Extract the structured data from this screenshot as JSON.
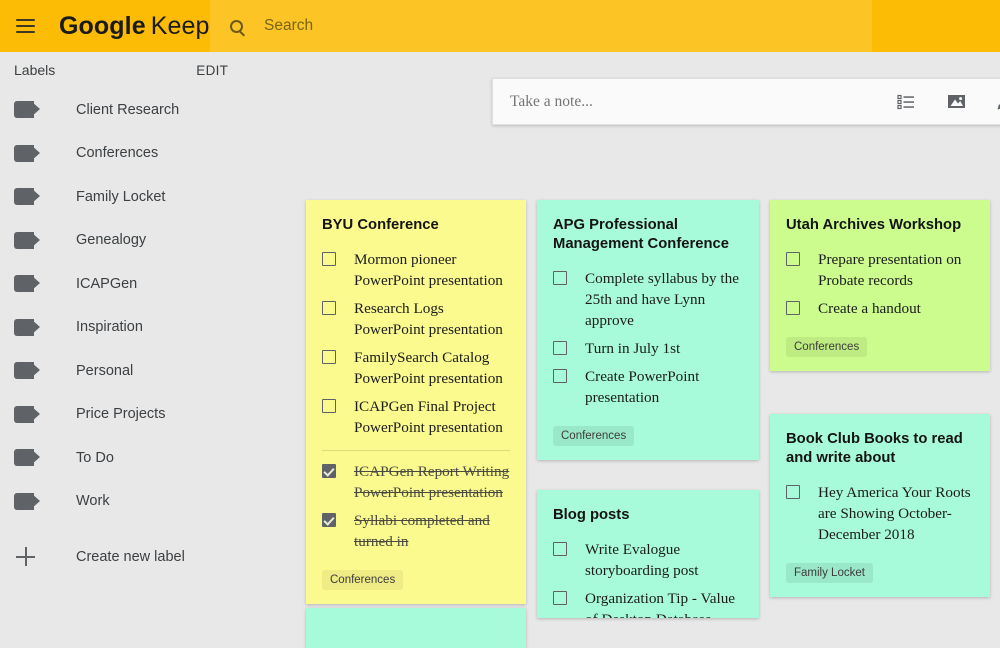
{
  "header": {
    "menu_icon": "hamburger-menu-icon",
    "logo_primary": "Google",
    "logo_secondary": "Keep",
    "search_icon": "search-icon",
    "search_placeholder": "Search",
    "search_value": "",
    "background_color": "#fcbc05"
  },
  "sidebar": {
    "title": "Labels",
    "edit_label": "EDIT",
    "items": [
      {
        "label": "Client Research",
        "icon": "label-tag-icon"
      },
      {
        "label": "Conferences",
        "icon": "label-tag-icon"
      },
      {
        "label": "Family Locket",
        "icon": "label-tag-icon"
      },
      {
        "label": "Genealogy",
        "icon": "label-tag-icon"
      },
      {
        "label": "ICAPGen",
        "icon": "label-tag-icon"
      },
      {
        "label": "Inspiration",
        "icon": "label-tag-icon"
      },
      {
        "label": "Personal",
        "icon": "label-tag-icon"
      },
      {
        "label": "Price Projects",
        "icon": "label-tag-icon"
      },
      {
        "label": "To Do",
        "icon": "label-tag-icon"
      },
      {
        "label": "Work",
        "icon": "label-tag-icon"
      }
    ],
    "create_label": "Create new label",
    "create_icon": "plus-icon"
  },
  "composer": {
    "placeholder": "Take a note...",
    "value": "",
    "icons": [
      "checklist-icon",
      "image-icon",
      "brush-icon"
    ]
  },
  "notes": [
    {
      "id": "byu",
      "title": "BYU Conference",
      "color": "#fbfa8e",
      "items": [
        {
          "text": "Mormon pioneer PowerPoint presentation",
          "checked": false
        },
        {
          "text": "Research Logs PowerPoint presentation",
          "checked": false
        },
        {
          "text": "FamilySearch Catalog PowerPoint presentation",
          "checked": false
        },
        {
          "text": "ICAPGen Final Project PowerPoint presentation",
          "checked": false
        },
        {
          "text": "ICAPGen Report Writing PowerPoint presentation",
          "checked": true
        },
        {
          "text": "Syllabi completed and turned in",
          "checked": true
        }
      ],
      "chip": "Conferences"
    },
    {
      "id": "apg",
      "title": "APG Professional Management Conference",
      "color": "#a7fada",
      "items": [
        {
          "text": "Complete syllabus by the 25th and have Lynn approve",
          "checked": false
        },
        {
          "text": "Turn in July 1st",
          "checked": false
        },
        {
          "text": "Create PowerPoint presentation",
          "checked": false
        }
      ],
      "chip": "Conferences"
    },
    {
      "id": "blog",
      "title": "Blog posts",
      "color": "#a7fada",
      "items": [
        {
          "text": "Write Evalogue storyboarding post",
          "checked": false
        },
        {
          "text": "Organization Tip - Value of Desktop Database",
          "checked": false
        }
      ],
      "chip": ""
    },
    {
      "id": "utah",
      "title": "Utah Archives Workshop",
      "color": "#ccfb8e",
      "items": [
        {
          "text": "Prepare presentation on Probate records",
          "checked": false
        },
        {
          "text": "Create a handout",
          "checked": false
        }
      ],
      "chip": "Conferences"
    },
    {
      "id": "book",
      "title": "Book Club Books to read and write about",
      "color": "#a7fada",
      "items": [
        {
          "text": "Hey America Your Roots are Showing October-December 2018",
          "checked": false
        }
      ],
      "chip": "Family Locket"
    }
  ]
}
